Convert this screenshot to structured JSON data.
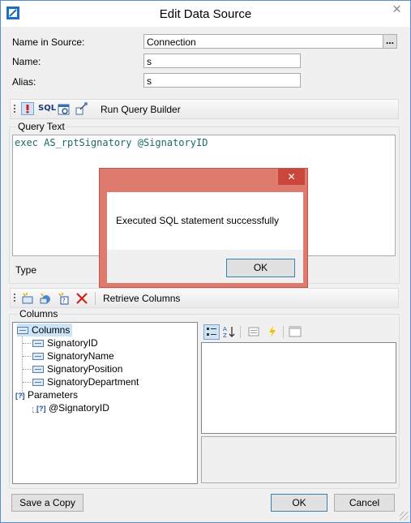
{
  "window": {
    "title": "Edit Data Source",
    "close_glyph": "✕"
  },
  "form": {
    "name_in_source_label": "Name in Source:",
    "name_in_source_value": "Connection",
    "browse_label": "...",
    "name_label": "Name:",
    "name_value": "s",
    "alias_label": "Alias:",
    "alias_value": "s"
  },
  "query_toolbar": {
    "sql_label": "SQL",
    "run_query_builder_label": "Run Query Builder"
  },
  "query": {
    "section_label": "Query Text",
    "text": "exec AS_rptSignatory @SignatoryID",
    "type_label": "Type"
  },
  "columns_toolbar": {
    "retrieve_columns_label": "Retrieve Columns"
  },
  "columns": {
    "section_label": "Columns",
    "tree": {
      "columns_root": "Columns",
      "column_items": [
        "SignatoryID",
        "SignatoryName",
        "SignatoryPosition",
        "SignatoryDepartment"
      ],
      "parameters_root": "Parameters",
      "parameter_items": [
        "@SignatoryID"
      ]
    }
  },
  "footer": {
    "save_copy_label": "Save a Copy",
    "ok_label": "OK",
    "cancel_label": "Cancel"
  },
  "dialog": {
    "message": "Executed SQL statement successfully",
    "ok_label": "OK",
    "close_glyph": "✕"
  },
  "colors": {
    "dialog_frame": "#df7a6e",
    "dialog_close": "#c9483b",
    "query_text": "#1a6a6a",
    "accent_blue": "#3c7fb1"
  },
  "icons": [
    "app-icon",
    "exclamation-icon",
    "sql-icon",
    "view-data-icon",
    "query-builder-icon",
    "new-column-icon",
    "new-calc-column-icon",
    "new-parameter-icon",
    "delete-icon",
    "categorized-icon",
    "sort-alpha-icon",
    "properties-icon",
    "events-icon",
    "property-pages-icon"
  ]
}
